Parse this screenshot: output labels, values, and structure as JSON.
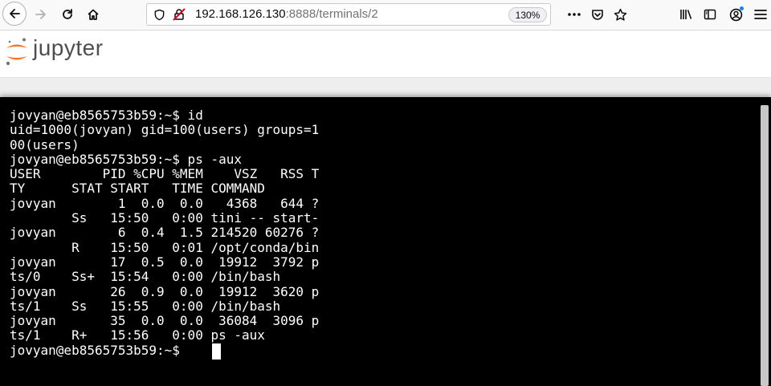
{
  "browser": {
    "url": {
      "host": "192.168.126.130",
      "rest": ":8888/terminals/2"
    },
    "zoom": "130%"
  },
  "jupyter": {
    "logo_text": "jupyter"
  },
  "terminal": {
    "lines": [
      "jovyan@eb8565753b59:~$ id",
      "uid=1000(jovyan) gid=100(users) groups=1",
      "00(users)",
      "jovyan@eb8565753b59:~$ ps -aux",
      "USER        PID %CPU %MEM    VSZ   RSS T",
      "TY      STAT START   TIME COMMAND",
      "jovyan        1  0.0  0.0   4368   644 ?",
      "        Ss   15:50   0:00 tini -- start-",
      "jovyan        6  0.4  1.5 214520 60276 ?",
      "        R    15:50   0:01 /opt/conda/bin",
      "jovyan       17  0.5  0.0  19912  3792 p",
      "ts/0    Ss+  15:54   0:00 /bin/bash",
      "jovyan       26  0.9  0.0  19912  3620 p",
      "ts/1    Ss   15:55   0:00 /bin/bash",
      "jovyan       35  0.0  0.0  36084  3096 p",
      "ts/1    R+   15:56   0:00 ps -aux",
      "jovyan@eb8565753b59:~$ "
    ]
  }
}
